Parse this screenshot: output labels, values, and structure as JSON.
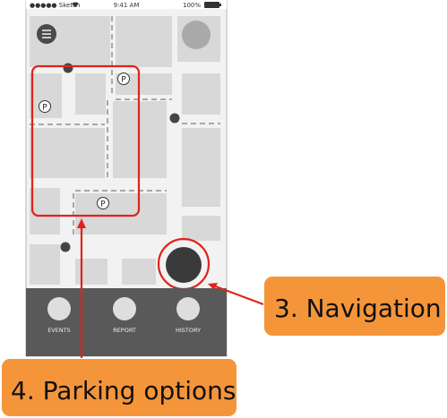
{
  "status_bar": {
    "carrier": "●●●●● Sketch",
    "time": "9:41 AM",
    "battery": "100%",
    "wifi_icon": "wifi-icon",
    "battery_icon": "battery-icon"
  },
  "map": {
    "menu_icon": "hamburger-menu-icon",
    "profile_icon": "avatar",
    "parking_symbol": "P",
    "parking_region_color": "#e0231b"
  },
  "tab_bar": {
    "background": "#595959",
    "tabs": [
      {
        "label": "EVENTS"
      },
      {
        "label": "REPORT"
      },
      {
        "label": "HISTORY"
      }
    ]
  },
  "callouts": {
    "color": "#f5953a",
    "navigation": "3. Navigation",
    "parking": "4. Parking options"
  }
}
